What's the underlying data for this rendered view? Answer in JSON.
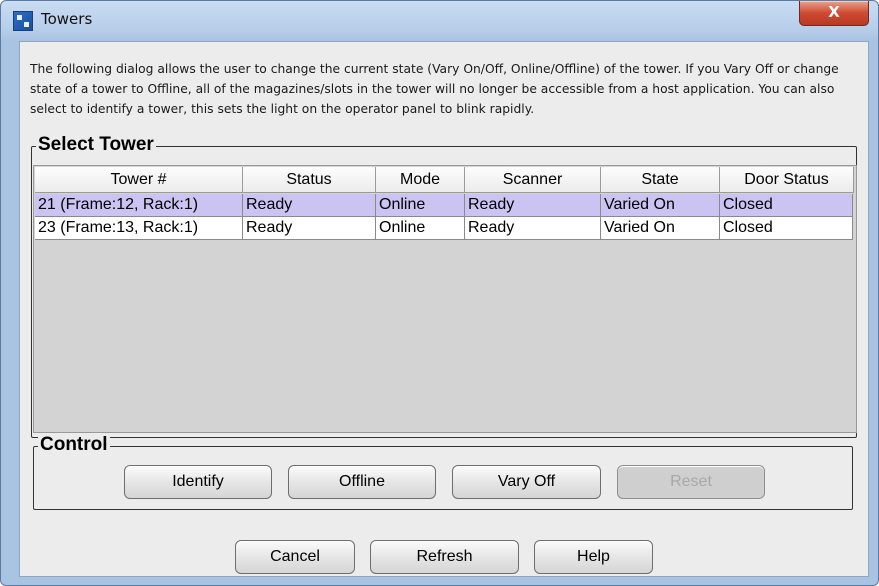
{
  "window": {
    "title": "Towers",
    "close_label": "X"
  },
  "description": "The following dialog allows the user to change the current state (Vary On/Off, Online/Offline) of the tower. If you Vary Off or change state of a tower to Offline, all of the magazines/slots in the tower will no longer be accessible from a host application. You can also select to identify a tower, this sets the light on the operator panel to blink rapidly.",
  "select_tower": {
    "legend": "Select Tower",
    "columns": [
      "Tower #",
      "Status",
      "Mode",
      "Scanner",
      "State",
      "Door Status"
    ],
    "rows": [
      [
        "21 (Frame:12, Rack:1)",
        "Ready",
        "Online",
        "Ready",
        "Varied On",
        "Closed"
      ],
      [
        "23 (Frame:13, Rack:1)",
        "Ready",
        "Online",
        "Ready",
        "Varied On",
        "Closed"
      ]
    ],
    "selected_row": 0,
    "colors": {
      "selected": "#cbc4f2",
      "empty_area": "#d3d3d3"
    }
  },
  "control": {
    "legend": "Control",
    "buttons": {
      "identify": "Identify",
      "offline": "Offline",
      "vary_off": "Vary Off",
      "reset": "Reset"
    }
  },
  "footer": {
    "cancel": "Cancel",
    "refresh": "Refresh",
    "help": "Help"
  }
}
